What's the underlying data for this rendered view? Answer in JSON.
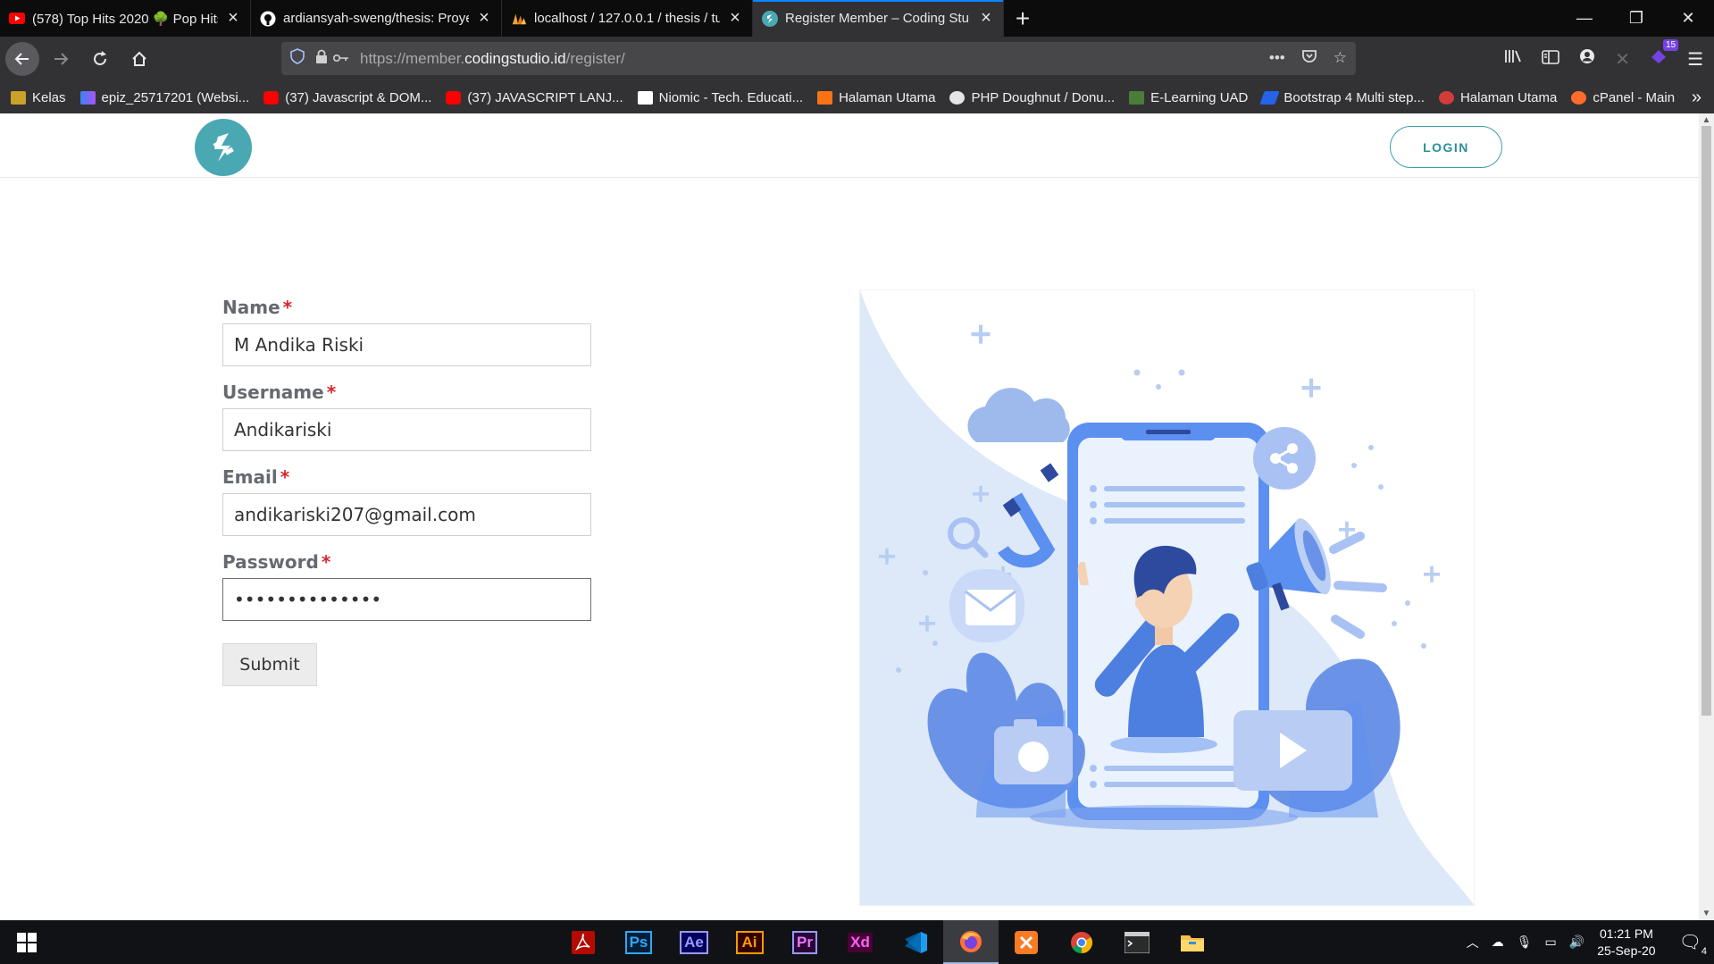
{
  "browser": {
    "tabs": [
      {
        "title": "(578) Top Hits 2020 🌳 Pop Hits",
        "icon": "youtube-icon",
        "active": false
      },
      {
        "title": "ardiansyah-sweng/thesis: Proye",
        "icon": "github-icon",
        "active": false
      },
      {
        "title": "localhost / 127.0.0.1 / thesis / tu",
        "icon": "phpmyadmin-icon",
        "active": false
      },
      {
        "title": "Register Member – Coding Stu",
        "icon": "codingstudio-icon",
        "active": true
      }
    ],
    "url_prefix": "https://member.",
    "url_domain": "codingstudio.id",
    "url_path": "/register/",
    "extension_badge": "15",
    "bookmarks": [
      {
        "label": "Kelas",
        "color": "#c9a227"
      },
      {
        "label": "epiz_25717201 (Websi...",
        "color": "#3b82f6"
      },
      {
        "label": "(37) Javascript & DOM...",
        "color": "#ff0000"
      },
      {
        "label": "(37) JAVASCRIPT LANJ...",
        "color": "#ff0000"
      },
      {
        "label": "Niomic - Tech. Educati...",
        "color": "#ffffff"
      },
      {
        "label": "Halaman Utama",
        "color": "#f97316"
      },
      {
        "label": "PHP Doughnut / Donu...",
        "color": "#e5e5e5"
      },
      {
        "label": "E-Learning UAD",
        "color": "#4b7d3a"
      },
      {
        "label": "Bootstrap 4 Multi step...",
        "color": "#2563eb"
      },
      {
        "label": "Halaman Utama",
        "color": "#d43b3b"
      },
      {
        "label": "cPanel - Main",
        "color": "#ff6c2c"
      }
    ]
  },
  "site": {
    "login_label": "LOGIN",
    "form": {
      "name_label": "Name",
      "name_value": "M Andika Riski",
      "username_label": "Username",
      "username_value": "Andikariski",
      "email_label": "Email",
      "email_value": "andikariski207@gmail.com",
      "password_label": "Password",
      "password_value": "••••••••••••••",
      "required_mark": "*",
      "submit_label": "Submit"
    }
  },
  "taskbar": {
    "apps": [
      "Acrobat",
      "Ps",
      "Ae",
      "Ai",
      "Pr",
      "Xd",
      "VS Code",
      "Firefox",
      "XAMPP",
      "Chrome",
      "Terminal",
      "Explorer"
    ],
    "time": "01:21 PM",
    "date": "25-Sep-20",
    "notification_count": "4"
  },
  "colors": {
    "accent": "#4aa8b3",
    "required": "#d9262b",
    "illustration_blue": "#4d7fe0"
  }
}
